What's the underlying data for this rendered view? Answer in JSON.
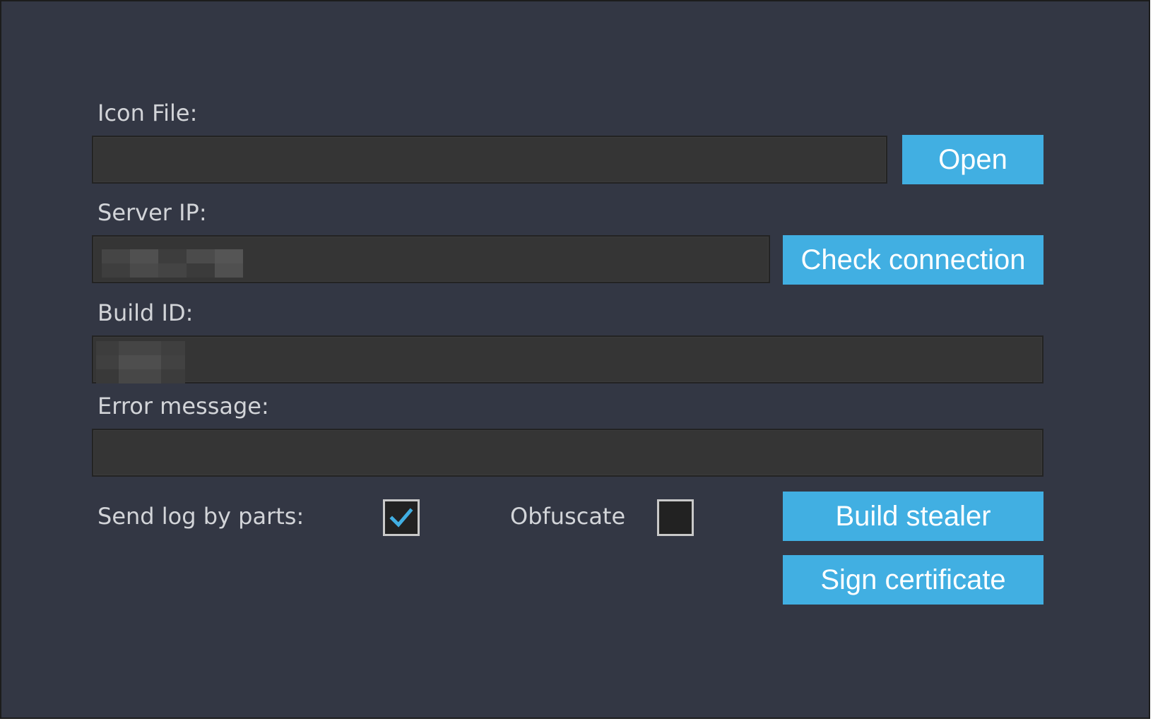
{
  "form": {
    "icon_file_label": "Icon File:",
    "icon_file_value": "",
    "open_button": "Open",
    "server_ip_label": "Server IP:",
    "server_ip_value": "",
    "check_connection_button": "Check connection",
    "build_id_label": "Build ID:",
    "build_id_value": "",
    "error_message_label": "Error message:",
    "error_message_value": "",
    "send_log_label": "Send log by parts:",
    "send_log_checked": true,
    "obfuscate_label": "Obfuscate",
    "obfuscate_checked": false,
    "build_button": "Build stealer",
    "sign_button": "Sign certificate"
  },
  "colors": {
    "background": "#333744",
    "field_bg": "#353535",
    "button": "#41afe2",
    "checkmark": "#41afe2",
    "label": "#d2d4d8"
  },
  "icons": {
    "checkmark": "check-icon"
  }
}
